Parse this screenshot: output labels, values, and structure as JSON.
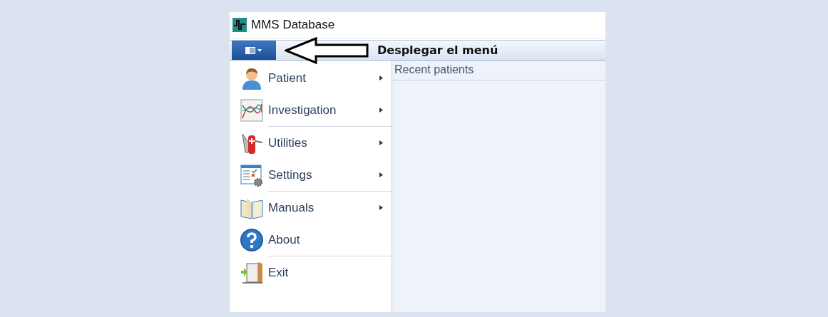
{
  "window": {
    "title": "MMS Database"
  },
  "annotation": {
    "text": "Desplegar el menú"
  },
  "menu": {
    "items": [
      {
        "label": "Patient",
        "has_submenu": true,
        "separator_after": false
      },
      {
        "label": "Investigation",
        "has_submenu": true,
        "separator_after": true
      },
      {
        "label": "Utilities",
        "has_submenu": true,
        "separator_after": false
      },
      {
        "label": "Settings",
        "has_submenu": true,
        "separator_after": true
      },
      {
        "label": "Manuals",
        "has_submenu": true,
        "separator_after": false
      },
      {
        "label": "About",
        "has_submenu": false,
        "separator_after": true
      },
      {
        "label": "Exit",
        "has_submenu": false,
        "separator_after": false
      }
    ]
  },
  "recent": {
    "title": "Recent patients"
  }
}
